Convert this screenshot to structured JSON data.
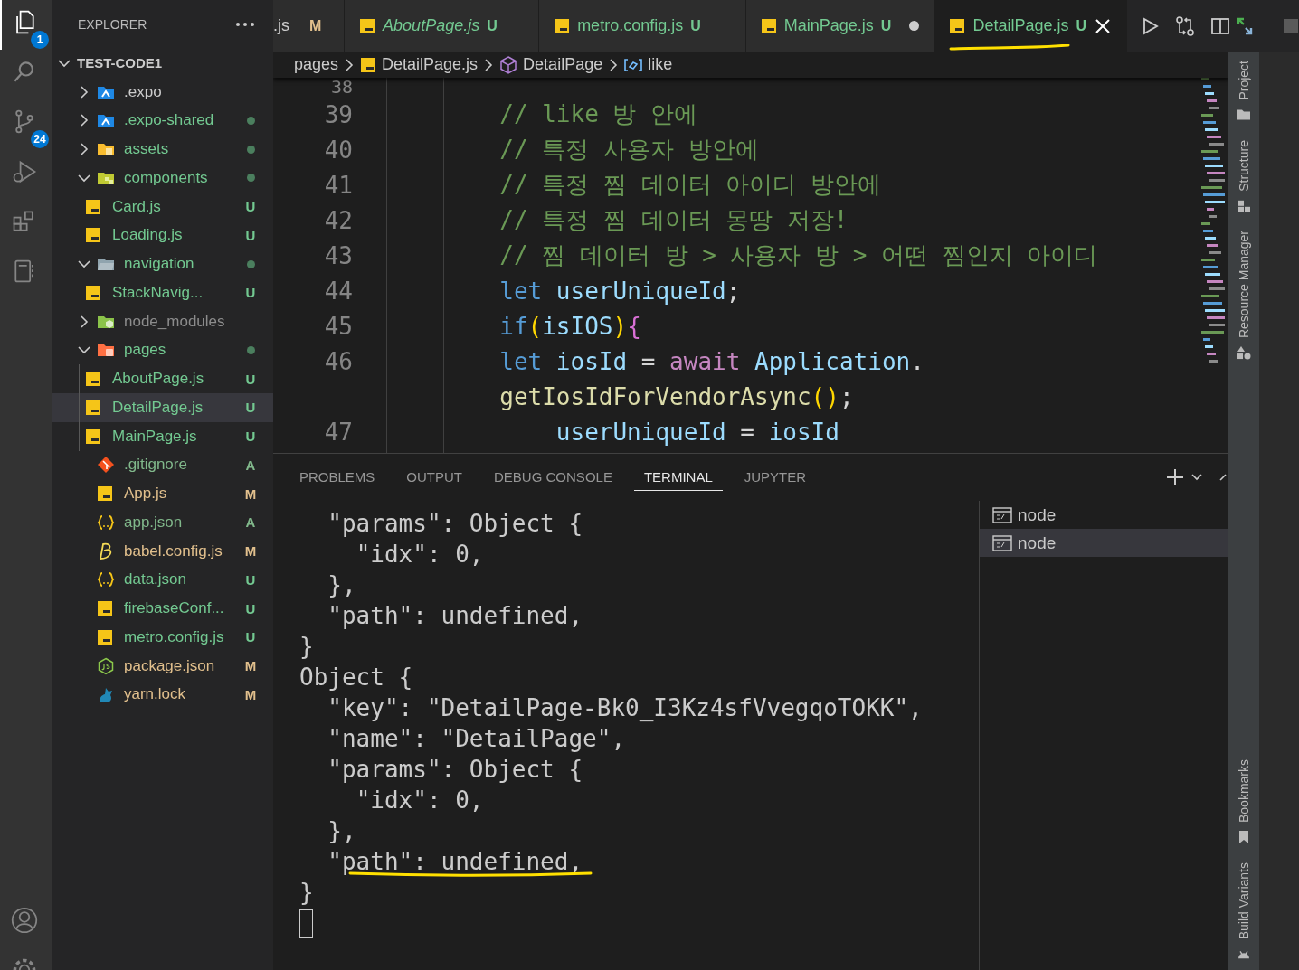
{
  "activity_bar": {
    "items": [
      {
        "kind": "explorer",
        "selected": true,
        "badge": "1"
      },
      {
        "kind": "search",
        "selected": false
      },
      {
        "kind": "source-control",
        "selected": false,
        "badge": "24"
      },
      {
        "kind": "run-debug",
        "selected": false
      },
      {
        "kind": "extensions",
        "selected": false
      },
      {
        "kind": "notebook",
        "selected": false
      }
    ],
    "bottom": [
      {
        "kind": "account"
      },
      {
        "kind": "settings"
      }
    ]
  },
  "explorer": {
    "title": "EXPLORER",
    "workspace": {
      "name": "TEST-CODE1",
      "expanded": true
    },
    "items": [
      {
        "name": ".expo",
        "kind": "folder-expo",
        "expanded": false,
        "selected": false
      },
      {
        "name": ".expo-shared",
        "kind": "folder-expo",
        "expanded": false,
        "dot": true,
        "selected": false
      },
      {
        "name": "assets",
        "kind": "folder-assets",
        "expanded": false,
        "dot": true,
        "selected": false
      },
      {
        "name": "components",
        "kind": "folder-components",
        "expanded": true,
        "dot": true,
        "selected": false,
        "children": [
          {
            "name": "Card.js",
            "kind": "js",
            "status": "U",
            "selected": false
          },
          {
            "name": "Loading.js",
            "kind": "js",
            "status": "U",
            "selected": false
          }
        ]
      },
      {
        "name": "navigation",
        "kind": "folder-navigation",
        "expanded": true,
        "dot": true,
        "selected": false,
        "children": [
          {
            "name": "StackNavig...",
            "kind": "js",
            "status": "U",
            "selected": false
          }
        ]
      },
      {
        "name": "node_modules",
        "kind": "folder-node",
        "expanded": false,
        "ignored": true,
        "selected": false
      },
      {
        "name": "pages",
        "kind": "folder-pages",
        "expanded": true,
        "dot": true,
        "selected": false,
        "children": [
          {
            "name": "AboutPage.js",
            "kind": "js",
            "status": "U",
            "selected": false
          },
          {
            "name": "DetailPage.js",
            "kind": "js",
            "status": "U",
            "selected": true
          },
          {
            "name": "MainPage.js",
            "kind": "js",
            "status": "U",
            "selected": false
          }
        ]
      },
      {
        "name": ".gitignore",
        "kind": "git",
        "status": "A",
        "selected": false
      },
      {
        "name": "App.js",
        "kind": "js",
        "status": "M",
        "selected": false
      },
      {
        "name": "app.json",
        "kind": "json",
        "status": "A",
        "selected": false
      },
      {
        "name": "babel.config.js",
        "kind": "babel",
        "status": "M",
        "selected": false
      },
      {
        "name": "data.json",
        "kind": "json",
        "status": "U",
        "selected": false
      },
      {
        "name": "firebaseConf...",
        "kind": "js",
        "status": "U",
        "selected": false
      },
      {
        "name": "metro.config.js",
        "kind": "js",
        "status": "U",
        "selected": false
      },
      {
        "name": "package.json",
        "kind": "nodejs",
        "status": "M",
        "selected": false
      },
      {
        "name": "yarn.lock",
        "kind": "yarn",
        "status": "M",
        "selected": false
      }
    ]
  },
  "tabs": [
    {
      "label": ".js",
      "status": "M",
      "git_colored": false,
      "selected": false,
      "preview": false,
      "dirty": false,
      "annotated": false
    },
    {
      "label": "AboutPage.js",
      "status": "U",
      "git_colored": true,
      "selected": false,
      "preview": true,
      "dirty": false,
      "annotated": false
    },
    {
      "label": "metro.config.js",
      "status": "U",
      "git_colored": true,
      "selected": false,
      "preview": false,
      "dirty": false,
      "annotated": false
    },
    {
      "label": "MainPage.js",
      "status": "U",
      "git_colored": true,
      "selected": false,
      "preview": false,
      "dirty": true,
      "annotated": false
    },
    {
      "label": "DetailPage.js",
      "status": "U",
      "git_colored": true,
      "selected": true,
      "preview": false,
      "dirty": false,
      "annotated": true
    }
  ],
  "breadcrumb": [
    {
      "text": "pages",
      "kind": "folder"
    },
    {
      "text": "DetailPage.js",
      "kind": "js"
    },
    {
      "text": "DetailPage",
      "kind": "component"
    },
    {
      "text": "like",
      "kind": "variable"
    }
  ],
  "editor": {
    "lines": [
      {
        "number": "38"
      },
      {
        "number": "39",
        "tokens": [
          {
            "kind": "comment",
            "text": "        // like 방 안에"
          }
        ]
      },
      {
        "number": "40",
        "tokens": [
          {
            "kind": "comment",
            "text": "        // 특정 사용자 방안에"
          }
        ]
      },
      {
        "number": "41",
        "tokens": [
          {
            "kind": "comment",
            "text": "        // 특정 찜 데이터 아이디 방안에"
          }
        ]
      },
      {
        "number": "42",
        "tokens": [
          {
            "kind": "comment",
            "text": "        // 특정 찜 데이터 몽땅 저장!"
          }
        ]
      },
      {
        "number": "43",
        "tokens": [
          {
            "kind": "comment",
            "text": "        // 찜 데이터 방 > 사용자 방 > 어떤 찜인지 아이디"
          }
        ]
      },
      {
        "number": "44",
        "tokens": [
          {
            "kind": "keyword",
            "text": "        let "
          },
          {
            "kind": "variable",
            "text": "userUniqueId"
          },
          {
            "kind": "punctuation",
            "text": ";"
          }
        ]
      },
      {
        "number": "45",
        "tokens": [
          {
            "kind": "keyword",
            "text": "        if"
          },
          {
            "kind": "bracket",
            "text": "("
          },
          {
            "kind": "variable",
            "text": "isIOS"
          },
          {
            "kind": "bracket",
            "text": ")"
          },
          {
            "kind": "brace",
            "text": "{"
          }
        ]
      },
      {
        "number": "46",
        "tokens": [
          {
            "kind": "keyword",
            "text": "        let "
          },
          {
            "kind": "variable",
            "text": "iosId"
          },
          {
            "kind": "punctuation",
            "text": " = "
          },
          {
            "kind": "control",
            "text": "await "
          },
          {
            "kind": "variable",
            "text": "Application"
          },
          {
            "kind": "punctuation",
            "text": "."
          }
        ]
      },
      {
        "tokens": [
          {
            "kind": "function",
            "text": "        getIosIdForVendorAsync"
          },
          {
            "kind": "bracket",
            "text": "()"
          },
          {
            "kind": "punctuation",
            "text": ";"
          }
        ]
      },
      {
        "number": "47",
        "tokens": [
          {
            "kind": "variable",
            "text": "            userUniqueId"
          },
          {
            "kind": "punctuation",
            "text": " = "
          },
          {
            "kind": "variable",
            "text": "iosId"
          }
        ]
      }
    ]
  },
  "panel": {
    "tabs": [
      {
        "label": "PROBLEMS",
        "selected": false
      },
      {
        "label": "OUTPUT",
        "selected": false
      },
      {
        "label": "DEBUG CONSOLE",
        "selected": false
      },
      {
        "label": "TERMINAL",
        "selected": true
      },
      {
        "label": "JUPYTER",
        "selected": false
      }
    ],
    "terminal": [
      {
        "text": "  \"params\": Object {",
        "annotated": false
      },
      {
        "text": "    \"idx\": 0,",
        "annotated": false
      },
      {
        "text": "  },",
        "annotated": false
      },
      {
        "text": "  \"path\": undefined,",
        "annotated": false
      },
      {
        "text": "}",
        "annotated": false
      },
      {
        "text": "Object {",
        "annotated": false
      },
      {
        "text": "  \"key\": \"DetailPage-Bk0_I3Kz4sfVvegqoTOKK\",",
        "annotated": false
      },
      {
        "text": "  \"name\": \"DetailPage\",",
        "annotated": false
      },
      {
        "text": "  \"params\": Object {",
        "annotated": false
      },
      {
        "text": "    \"idx\": 0,",
        "annotated": false
      },
      {
        "text": "  },",
        "annotated": false
      },
      {
        "text": "  \"path\": undefined,",
        "annotated": true
      },
      {
        "text": "}",
        "annotated": false
      }
    ],
    "terminals": [
      {
        "label": "node",
        "selected": false
      },
      {
        "label": "node",
        "selected": true
      }
    ]
  },
  "tool_strip": {
    "top": [
      {
        "label": "Project",
        "kind": "folder"
      },
      {
        "label": "Structure",
        "kind": "structure"
      },
      {
        "label": "Resource Manager",
        "kind": "shapes"
      }
    ],
    "bottom": [
      {
        "label": "Bookmarks",
        "kind": "bookmark"
      },
      {
        "label": "Build Variants",
        "kind": "android"
      }
    ]
  }
}
